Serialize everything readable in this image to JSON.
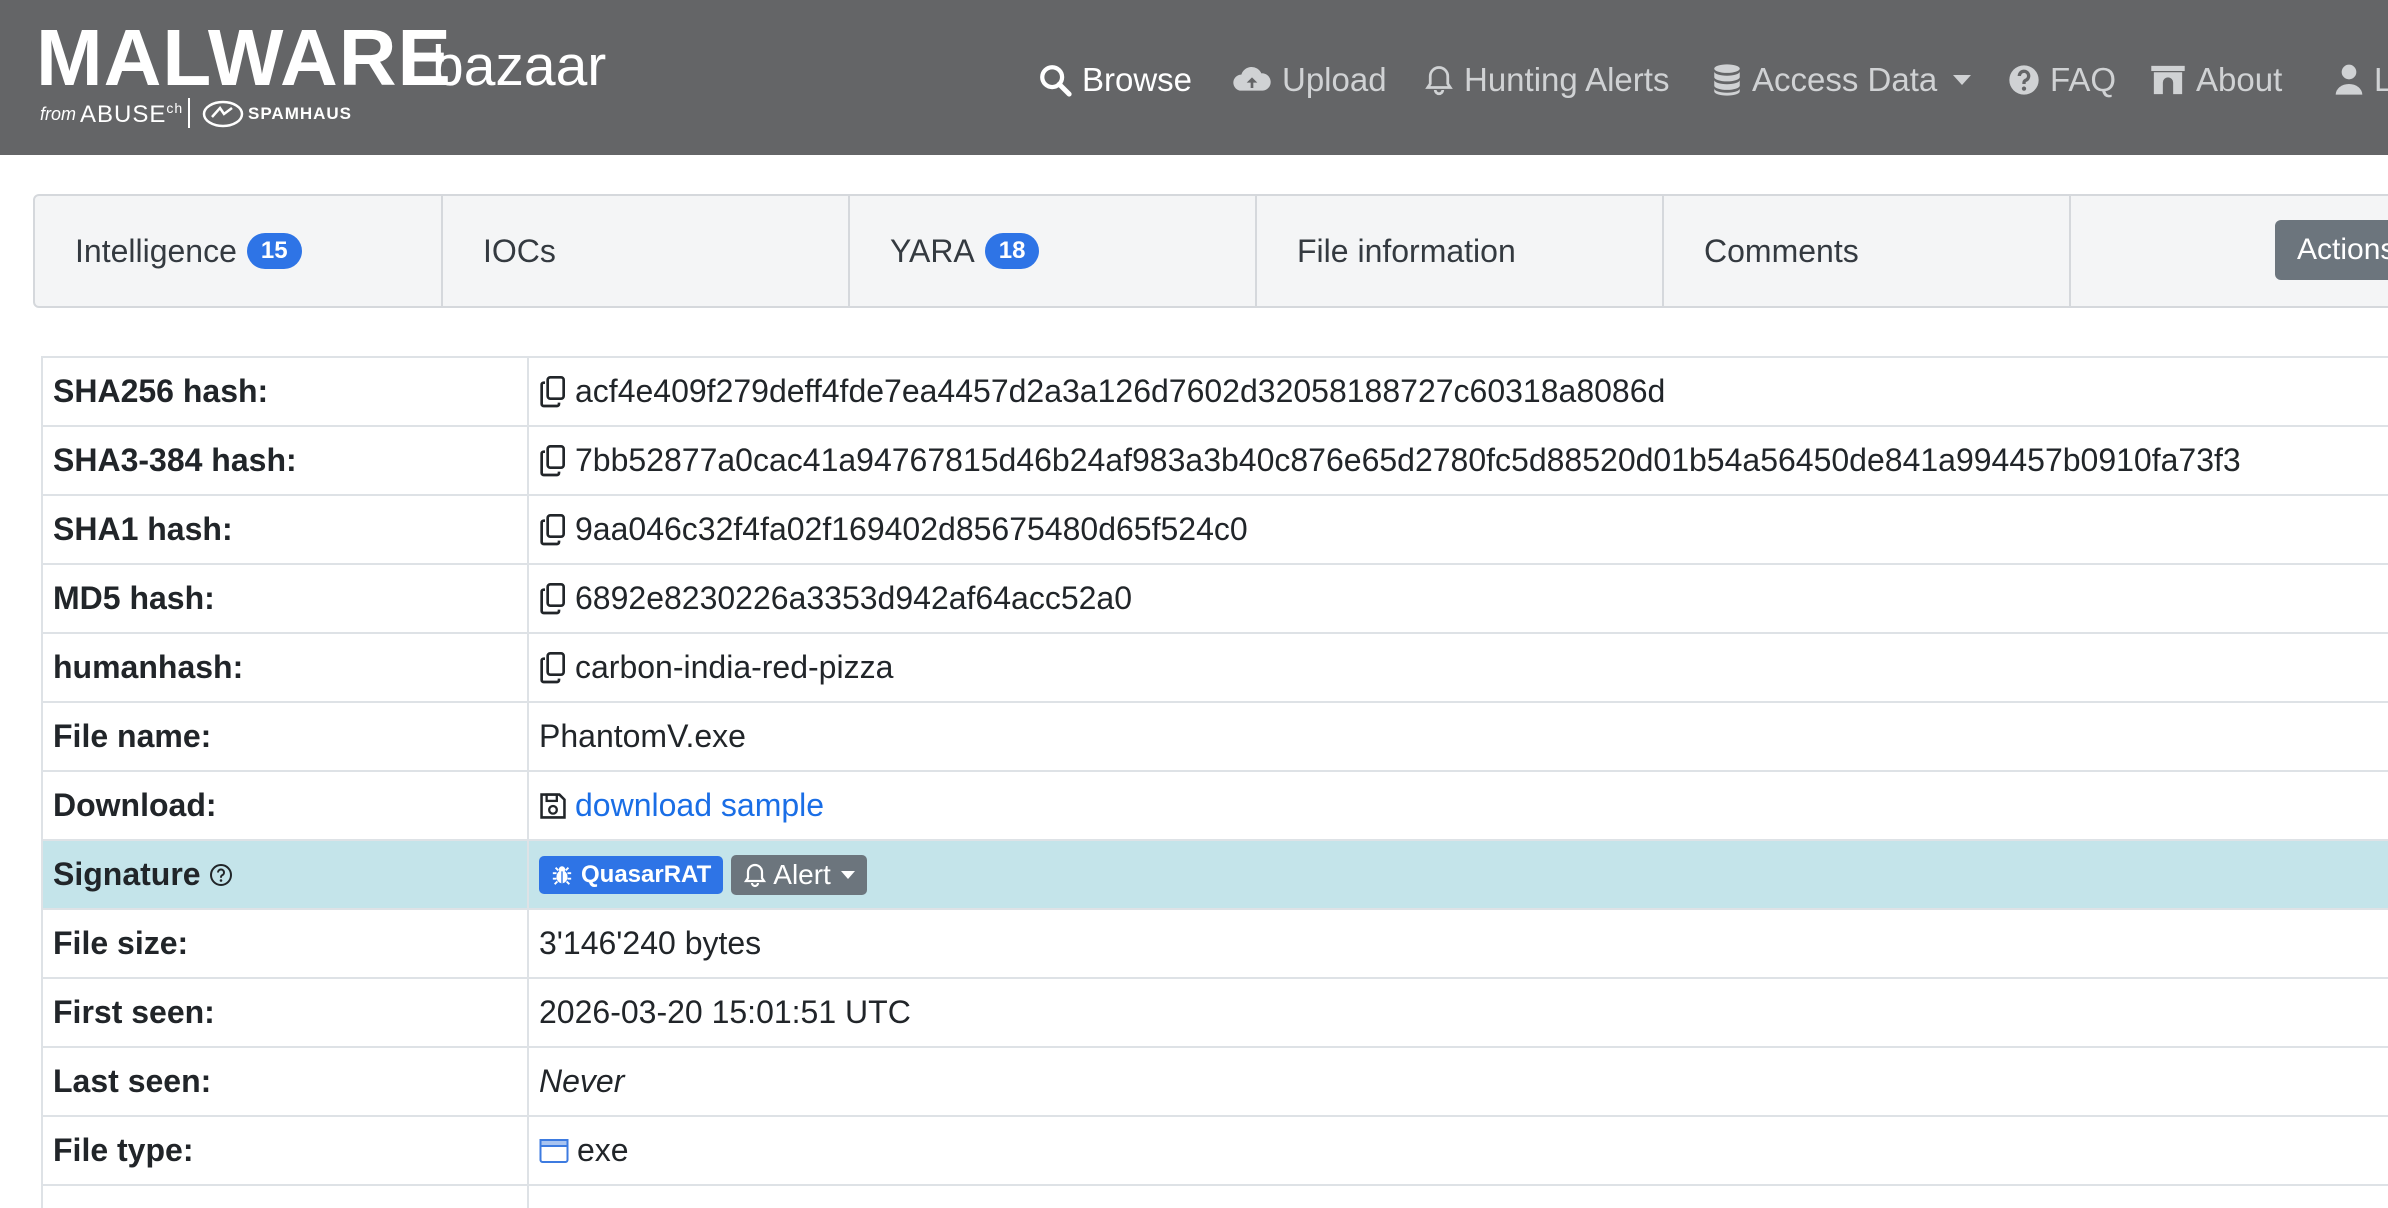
{
  "brand": {
    "name": "MALWARE",
    "sub": "bazaar",
    "from": "from",
    "abuse": "ABUSE",
    "abuse_sup": "ch",
    "spamhaus": "SPAMHAUS"
  },
  "nav": {
    "browse": "Browse",
    "upload": "Upload",
    "hunting": "Hunting Alerts",
    "access": "Access Data",
    "faq": "FAQ",
    "about": "About",
    "login": "Login"
  },
  "tabs": {
    "intelligence": "Intelligence",
    "intelligence_count": "15",
    "iocs": "IOCs",
    "yara": "YARA",
    "yara_count": "18",
    "file_info": "File information",
    "comments": "Comments",
    "actions": "Actions"
  },
  "details": {
    "sha256_label": "SHA256 hash:",
    "sha256": "acf4e409f279deff4fde7ea4457d2a3a126d7602d32058188727c60318a8086d",
    "sha3_label": "SHA3-384 hash:",
    "sha3": "7bb52877a0cac41a94767815d46b24af983a3b40c876e65d2780fc5d88520d01b54a56450de841a994457b0910fa73f3",
    "sha1_label": "SHA1 hash:",
    "sha1": "9aa046c32f4fa02f169402d85675480d65f524c0",
    "md5_label": "MD5 hash:",
    "md5": "6892e8230226a3353d942af64acc52a0",
    "humanhash_label": "humanhash:",
    "humanhash": "carbon-india-red-pizza",
    "filename_label": "File name:",
    "filename": "PhantomV.exe",
    "download_label": "Download:",
    "download": "download sample",
    "signature_label": "Signature",
    "signature": "QuasarRAT",
    "alert": "Alert",
    "filesize_label": "File size:",
    "filesize": "3'146'240 bytes",
    "firstseen_label": "First seen:",
    "firstseen": "2026-03-20 15:01:51 UTC",
    "lastseen_label": "Last seen:",
    "lastseen": "Never",
    "filetype_label": "File type:",
    "filetype": "exe"
  },
  "colors": {
    "navbar": "#646567",
    "accent": "#2e74e6",
    "highlight_row": "#c4e4ea",
    "button_gray": "#6c757d"
  }
}
